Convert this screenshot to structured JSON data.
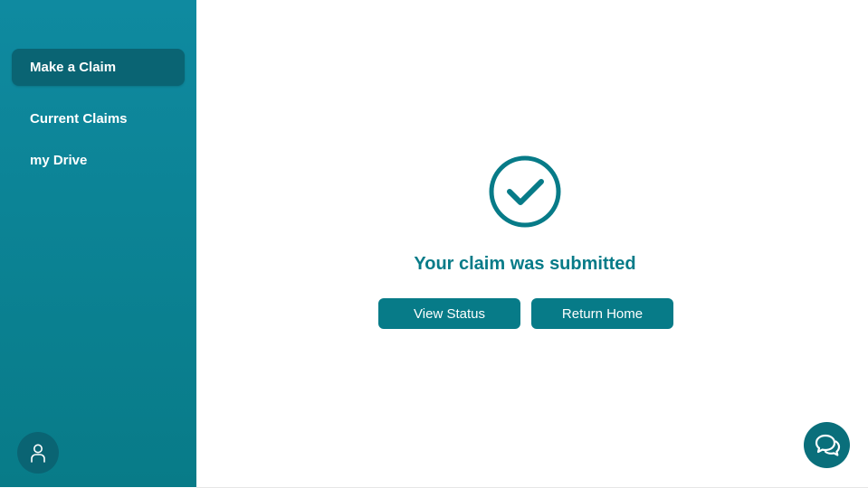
{
  "sidebar": {
    "items": [
      {
        "label": "Make a Claim",
        "active": true
      },
      {
        "label": "Current Claims",
        "active": false
      },
      {
        "label": "my Drive",
        "active": false
      }
    ],
    "avatar_icon": "user-icon"
  },
  "main": {
    "status_icon": "check-circle-icon",
    "title": "Your claim was submitted",
    "buttons": {
      "view_status": "View Status",
      "return_home": "Return Home"
    }
  },
  "chat": {
    "icon": "chat-bubbles-icon"
  },
  "colors": {
    "primary": "#077b88",
    "sidebar_top": "#0f8aa0",
    "sidebar_active": "#0a6473",
    "background": "#ffffff"
  }
}
